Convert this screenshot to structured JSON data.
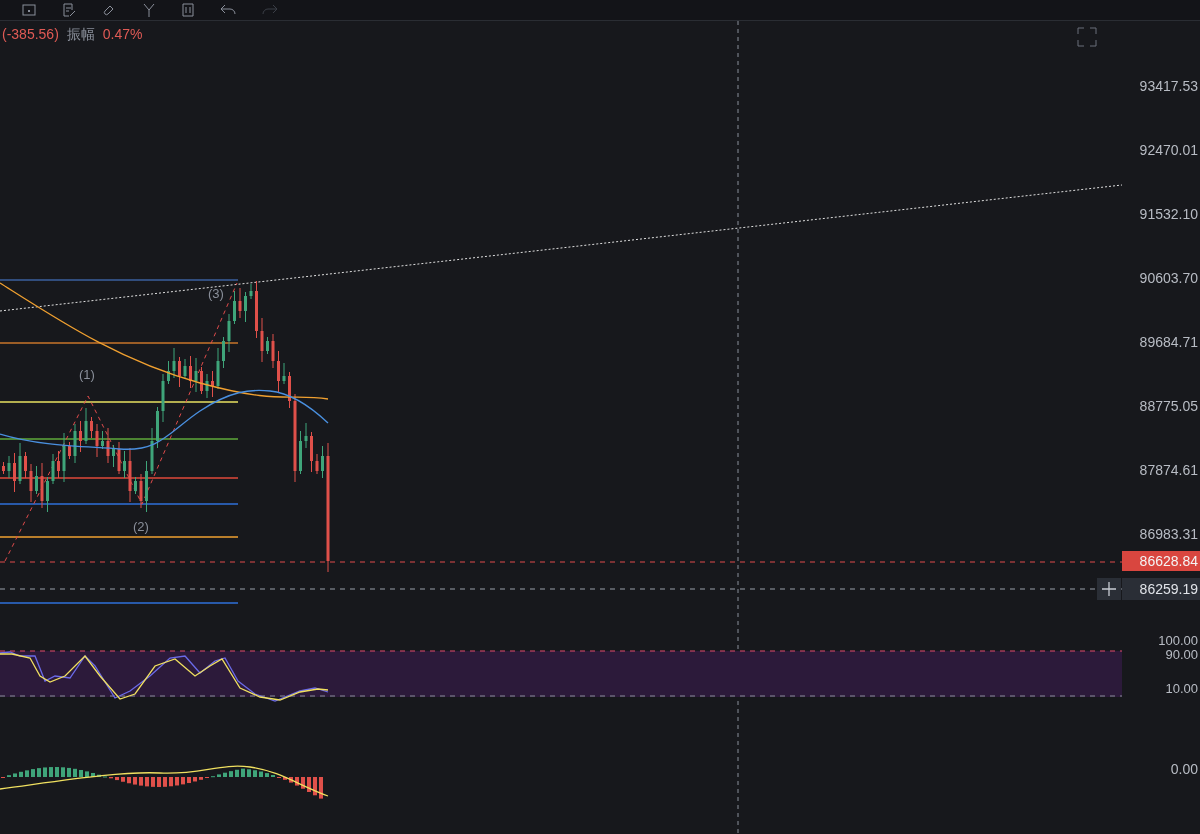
{
  "toolbar": {
    "undo": {
      "disabled": false
    },
    "redo": {
      "disabled": true
    }
  },
  "info": {
    "change": "(-385.56)",
    "amplitude_label": "振幅",
    "amplitude": "0.47%"
  },
  "price_axis": {
    "labels": [
      "93417.53",
      "92470.01",
      "91532.10",
      "90603.70",
      "89684.71",
      "88775.05",
      "87874.61",
      "86983.31"
    ]
  },
  "last_price": {
    "label": "86628.84"
  },
  "crosshair": {
    "label": "86259.19"
  },
  "wave_labels": [
    "(1)",
    "(2)",
    "(3)"
  ],
  "oscillator": {
    "labels": [
      "100.00",
      "90.00",
      "10.00"
    ]
  },
  "macd": {
    "labels": [
      "0.00"
    ]
  }
}
